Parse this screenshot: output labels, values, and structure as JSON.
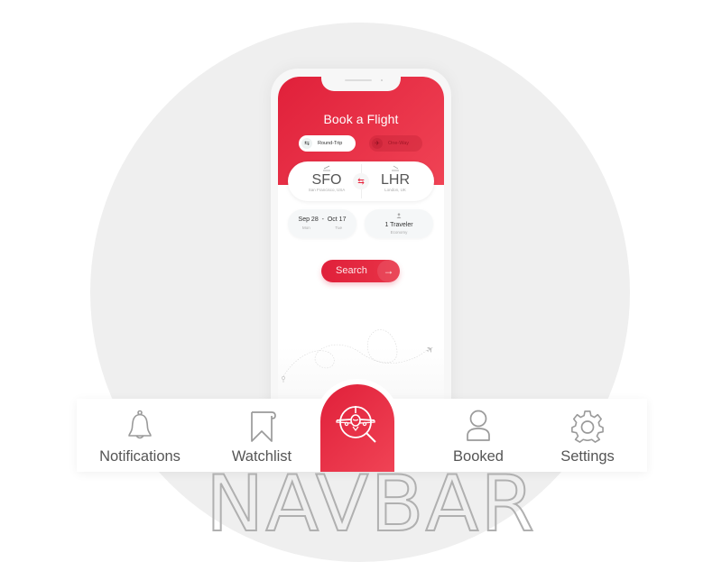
{
  "app": {
    "title": "Book a Flight",
    "trip_types": [
      {
        "label": "Round-Trip",
        "icon": "round-trip-icon",
        "selected": true
      },
      {
        "label": "One-Way",
        "icon": "one-way-icon",
        "selected": false
      }
    ],
    "route": {
      "from": {
        "code": "SFO",
        "city": "San Francisco, USA",
        "icon": "takeoff-icon"
      },
      "to": {
        "code": "LHR",
        "city": "London, UK",
        "icon": "landing-icon"
      },
      "swap_icon": "swap-arrows-icon"
    },
    "dates": {
      "depart": "Sep 28",
      "separator": "-",
      "return": "Oct 17",
      "depart_day": "Mon",
      "return_day": "Tue"
    },
    "travelers": {
      "count_label": "1 Traveler",
      "cabin": "Economy",
      "icon": "person-icon"
    },
    "search": {
      "label": "Search",
      "icon": "arrow-right-icon"
    }
  },
  "navbar": {
    "items": [
      {
        "label": "Notifications",
        "icon": "bell-icon"
      },
      {
        "label": "Watchlist",
        "icon": "bookmark-icon"
      },
      {
        "label": "",
        "icon": "plane-search-icon",
        "active": true
      },
      {
        "label": "Booked",
        "icon": "user-icon"
      },
      {
        "label": "Settings",
        "icon": "gear-icon"
      }
    ]
  },
  "caption": "NAVBAR",
  "colors": {
    "accent": "#e8233b",
    "icon_gray": "#9a9a9a",
    "background_circle": "#efefef"
  }
}
